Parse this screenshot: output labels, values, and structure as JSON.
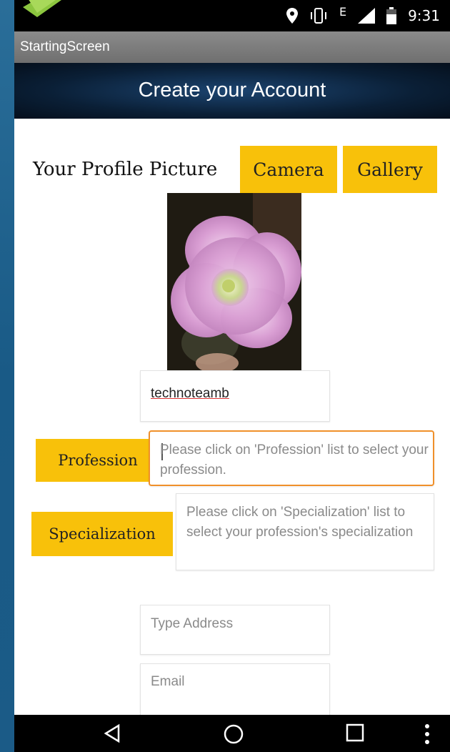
{
  "status_bar": {
    "time": "9:31",
    "network_label": "E",
    "icons": [
      "location-icon",
      "vibrate-icon",
      "signal-icon",
      "battery-icon"
    ]
  },
  "app": {
    "title": "StartingScreen",
    "header": "Create your Account"
  },
  "profile": {
    "label": "Your Profile Picture",
    "camera_button": "Camera",
    "gallery_button": "Gallery",
    "photo": "pink-flower-photo"
  },
  "form": {
    "username_value": "technoteamb",
    "profession_button": "Profession",
    "profession_placeholder": "Please click on 'Profession' list to select your profession.",
    "specialization_button": "Specialization",
    "specialization_placeholder": "Please click on 'Specialization' list to select your profession's specialization",
    "address_placeholder": "Type Address",
    "email_placeholder": "Email"
  },
  "nav": {
    "icons": [
      "back-icon",
      "home-icon",
      "recents-icon",
      "overflow-menu-icon"
    ]
  },
  "colors": {
    "accent_yellow": "#f8c10a",
    "focus_orange": "#f0902a",
    "header_dark": "#0a1f36"
  }
}
